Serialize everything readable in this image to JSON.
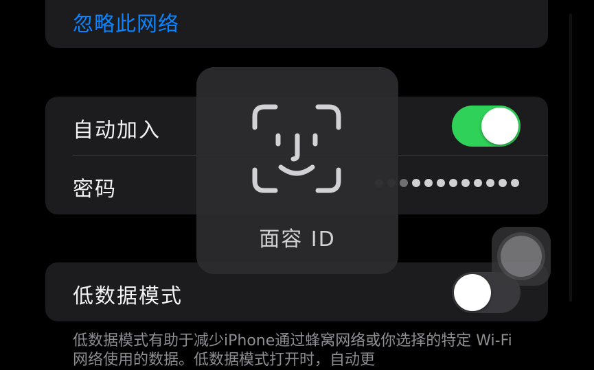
{
  "forget_network": {
    "label": "忽略此网络"
  },
  "auto_join": {
    "label": "自动加入",
    "on": true
  },
  "password": {
    "label": "密码",
    "masked_value": "••••••••••••••"
  },
  "low_data_mode": {
    "label": "低数据模式",
    "on": false,
    "description": "低数据模式有助于减少iPhone通过蜂窝网络或你选择的特定 Wi-Fi网络使用的数据。低数据模式打开时，自动更"
  },
  "face_id_hud": {
    "label": "面容 ID",
    "icon": "face-id-icon"
  },
  "colors": {
    "accent_link": "#0a84ff",
    "toggle_on": "#30d158",
    "toggle_off": "#39393d",
    "card": "#1c1c1e",
    "background": "#000000"
  }
}
